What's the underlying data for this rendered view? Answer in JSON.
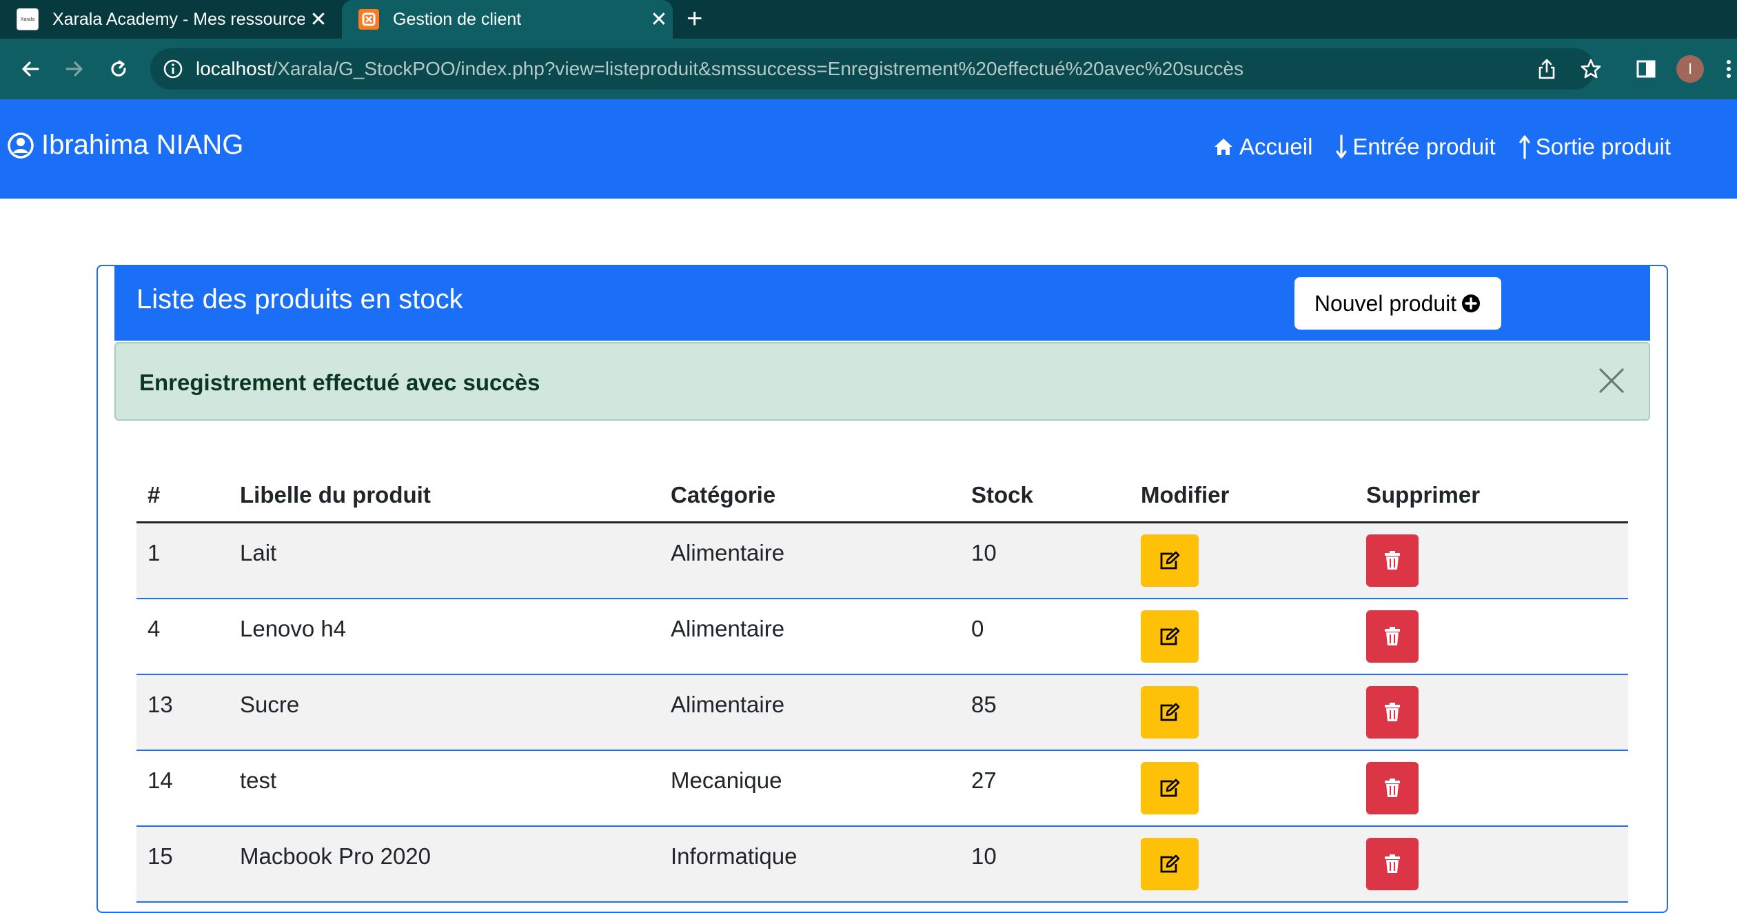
{
  "browser": {
    "tabs": [
      {
        "title": "Xarala Academy - Mes ressources",
        "favicon": "xarala-favicon"
      },
      {
        "title": "Gestion de client",
        "favicon": "xampp-favicon"
      }
    ],
    "new_tab_label": "+",
    "url_host": "localhost",
    "url_path": "/Xarala/G_StockPOO/index.php?view=listeproduit&smssuccess=Enregistrement%20effectué%20avec%20succès",
    "profile_initial": "I"
  },
  "navbar": {
    "brand": "Ibrahima NIANG",
    "links": {
      "home": "Accueil",
      "entry": "Entrée produit",
      "exit": "Sortie produit"
    }
  },
  "card": {
    "title": "Liste des produits en stock",
    "new_button": "Nouvel produit"
  },
  "alert": {
    "message": "Enregistrement effectué avec succès"
  },
  "table": {
    "headers": {
      "id": "#",
      "label": "Libelle du produit",
      "category": "Catégorie",
      "stock": "Stock",
      "edit": "Modifier",
      "delete": "Supprimer"
    },
    "rows": [
      {
        "id": "1",
        "label": "Lait",
        "category": "Alimentaire",
        "stock": "10"
      },
      {
        "id": "4",
        "label": "Lenovo h4",
        "category": "Alimentaire",
        "stock": "0"
      },
      {
        "id": "13",
        "label": "Sucre",
        "category": "Alimentaire",
        "stock": "85"
      },
      {
        "id": "14",
        "label": "test",
        "category": "Mecanique",
        "stock": "27"
      },
      {
        "id": "15",
        "label": "Macbook Pro 2020",
        "category": "Informatique",
        "stock": "10"
      }
    ]
  },
  "colors": {
    "primary": "#1b6ff7",
    "warning": "#ffc107",
    "danger": "#dc3545",
    "success_bg": "#d1e7dd",
    "success_text": "#0a3622"
  }
}
